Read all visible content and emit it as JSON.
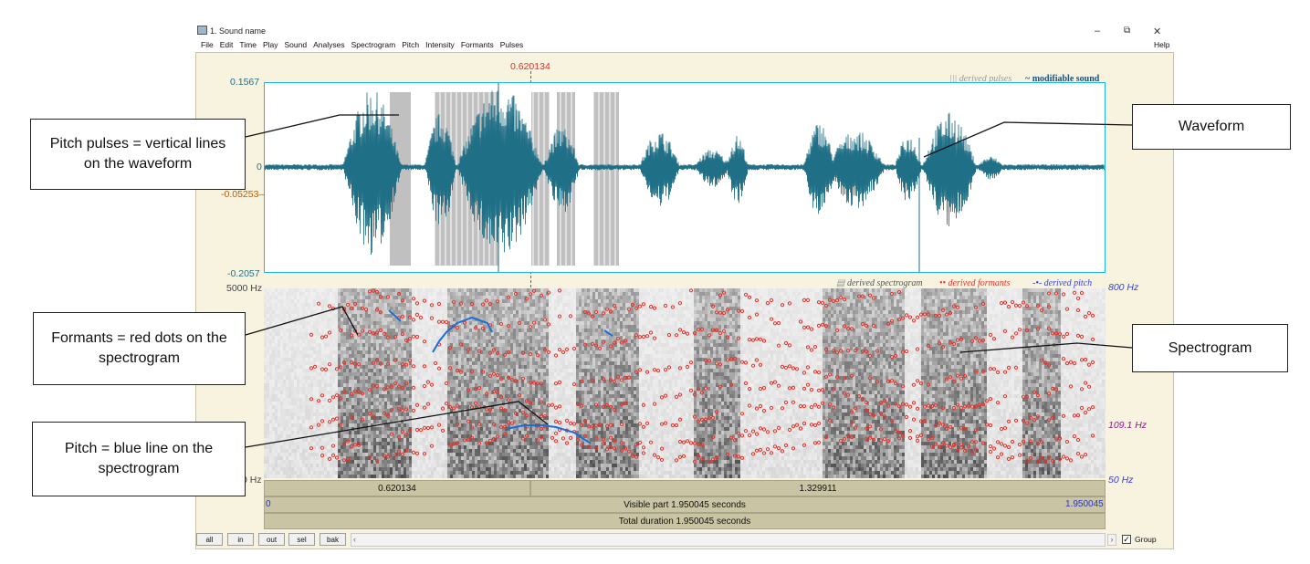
{
  "window": {
    "title": "1. Sound name",
    "menu": [
      "File",
      "Edit",
      "Time",
      "Play",
      "Sound",
      "Analyses",
      "Spectrogram",
      "Pitch",
      "Intensity",
      "Formants",
      "Pulses"
    ],
    "help": "Help",
    "controls": {
      "minimize": "–",
      "restore": "⧉",
      "close": "✕"
    }
  },
  "cursor": {
    "time_label": "0.620134"
  },
  "waveform": {
    "ymax": "0.1567",
    "zero": "0",
    "cursor_value": "-0.05253",
    "ymin": "-0.2057",
    "legend_pulses": "derived pulses",
    "legend_sound": "modifiable sound"
  },
  "spectrogram": {
    "top_hz": "5000 Hz",
    "bottom_hz": "0 Hz",
    "right_top": "800 Hz",
    "pitch_value": "109.1 Hz",
    "right_bottom": "50 Hz",
    "legend_spectrogram": "derived spectrogram",
    "legend_formants": "derived formants",
    "legend_pitch": "derived pitch"
  },
  "timebars": {
    "left_segment": "0.620134",
    "right_segment": "1.329911",
    "visible_start": "0",
    "visible_label": "Visible part 1.950045 seconds",
    "visible_end": "1.950045",
    "total_label": "Total duration 1.950045 seconds"
  },
  "buttons": {
    "all": "all",
    "in": "in",
    "out": "out",
    "sel": "sel",
    "bak": "bak",
    "group": "Group"
  },
  "annotations": {
    "pitch_pulses": "Pitch pulses = vertical lines on the waveform",
    "waveform": "Waveform",
    "formants": "Formants = red dots on the spectrogram",
    "spectrogram": "Spectrogram",
    "pitch": "Pitch = blue line on the spectrogram"
  },
  "colors": {
    "waveform": "#1f6f86",
    "wave_border": "#19b7e8",
    "cursor": "#e0302a",
    "formants": "#e8322a",
    "pitch": "#1a6fd6",
    "pulses": "#c0c0c0",
    "hz_label_blue": "#3a3fd0",
    "hz_label_purple": "#8a1a8a"
  }
}
